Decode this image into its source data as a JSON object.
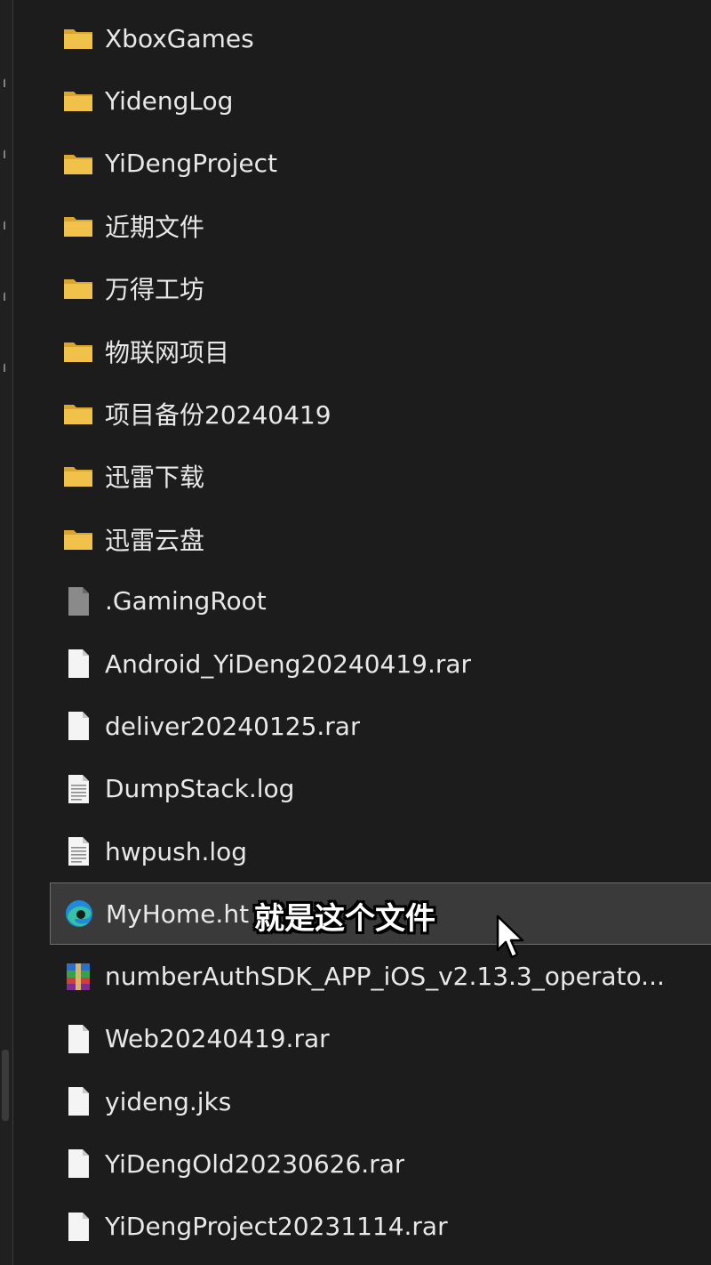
{
  "file_list": {
    "items": [
      {
        "name": "XboxGames",
        "icon": "folder-icon"
      },
      {
        "name": "YidengLog",
        "icon": "folder-icon"
      },
      {
        "name": "YiDengProject",
        "icon": "folder-icon"
      },
      {
        "name": "近期文件",
        "icon": "folder-icon"
      },
      {
        "name": "万得工坊",
        "icon": "folder-icon"
      },
      {
        "name": "物联网项目",
        "icon": "folder-icon"
      },
      {
        "name": "项目备份20240419",
        "icon": "folder-icon"
      },
      {
        "name": "迅雷下载",
        "icon": "folder-icon"
      },
      {
        "name": "迅雷云盘",
        "icon": "folder-icon"
      },
      {
        "name": ".GamingRoot",
        "icon": "system-file-icon"
      },
      {
        "name": "Android_YiDeng20240419.rar",
        "icon": "file-icon"
      },
      {
        "name": "deliver20240125.rar",
        "icon": "file-icon"
      },
      {
        "name": "DumpStack.log",
        "icon": "text-file-icon"
      },
      {
        "name": "hwpush.log",
        "icon": "text-file-icon"
      },
      {
        "name": "MyHome.ht",
        "icon": "edge-browser-icon",
        "selected": true
      },
      {
        "name": "numberAuthSDK_APP_iOS_v2.13.3_operato...",
        "icon": "winrar-archive-icon"
      },
      {
        "name": "Web20240419.rar",
        "icon": "file-icon"
      },
      {
        "name": "yideng.jks",
        "icon": "file-icon"
      },
      {
        "name": "YiDengOld20230626.rar",
        "icon": "file-icon"
      },
      {
        "name": "YiDengProject20231114.rar",
        "icon": "file-icon"
      }
    ]
  },
  "caption": "就是这个文件",
  "colors": {
    "background": "#1c1c1c",
    "folder": "#f0c24a",
    "selection": "#3a3a3a",
    "text": "#e8e8e8"
  }
}
